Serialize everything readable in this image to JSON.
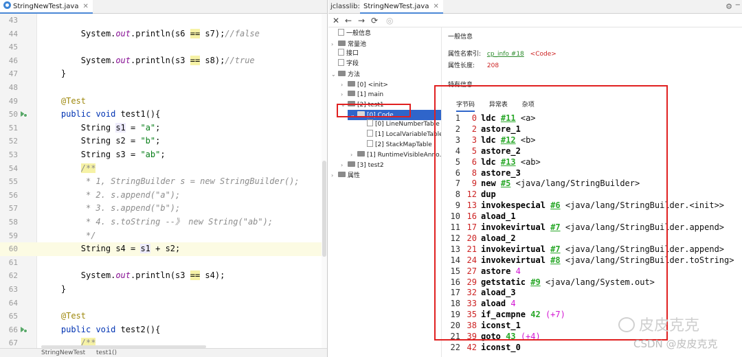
{
  "editor": {
    "tab_label": "StringNewTest.java",
    "lines": [
      {
        "num": "43",
        "code": []
      },
      {
        "num": "44",
        "code": [
          {
            "t": "System.",
            "c": ""
          },
          {
            "t": "out",
            "c": "fld"
          },
          {
            "t": ".println(s6 ",
            "c": ""
          },
          {
            "t": "==",
            "c": "op"
          },
          {
            "t": " s7);",
            "c": ""
          },
          {
            "t": "//false",
            "c": "cmt"
          }
        ],
        "indent": 8
      },
      {
        "num": "45",
        "code": []
      },
      {
        "num": "46",
        "code": [
          {
            "t": "System.",
            "c": ""
          },
          {
            "t": "out",
            "c": "fld"
          },
          {
            "t": ".println(s3 ",
            "c": ""
          },
          {
            "t": "==",
            "c": "op"
          },
          {
            "t": " s8);",
            "c": ""
          },
          {
            "t": "//true",
            "c": "cmt"
          }
        ],
        "indent": 8
      },
      {
        "num": "47",
        "code": [
          {
            "t": "}",
            "c": ""
          }
        ],
        "indent": 4
      },
      {
        "num": "48",
        "code": []
      },
      {
        "num": "49",
        "code": [
          {
            "t": "@Test",
            "c": "ann"
          }
        ],
        "indent": 4
      },
      {
        "num": "50",
        "code": [
          {
            "t": "public void ",
            "c": "kw"
          },
          {
            "t": "test1(){",
            "c": ""
          }
        ],
        "indent": 4,
        "marker": true
      },
      {
        "num": "51",
        "code": [
          {
            "t": "String ",
            "c": ""
          },
          {
            "t": "s1",
            "c": "hl"
          },
          {
            "t": " = ",
            "c": ""
          },
          {
            "t": "\"a\"",
            "c": "str"
          },
          {
            "t": ";",
            "c": ""
          }
        ],
        "indent": 8
      },
      {
        "num": "52",
        "code": [
          {
            "t": "String s2 = ",
            "c": ""
          },
          {
            "t": "\"b\"",
            "c": "str"
          },
          {
            "t": ";",
            "c": ""
          }
        ],
        "indent": 8
      },
      {
        "num": "53",
        "code": [
          {
            "t": "String s3 = ",
            "c": ""
          },
          {
            "t": "\"ab\"",
            "c": "str"
          },
          {
            "t": ";",
            "c": ""
          }
        ],
        "indent": 8
      },
      {
        "num": "54",
        "code": [
          {
            "t": "/**",
            "c": "cmt op"
          }
        ],
        "indent": 8
      },
      {
        "num": "55",
        "code": [
          {
            "t": " * 1, StringBuilder s = new StringBuilder();",
            "c": "cmt"
          }
        ],
        "indent": 8
      },
      {
        "num": "56",
        "code": [
          {
            "t": " * 2. s.append(\"a\");",
            "c": "cmt"
          }
        ],
        "indent": 8
      },
      {
        "num": "57",
        "code": [
          {
            "t": " * 3. s.append(\"b\");",
            "c": "cmt"
          }
        ],
        "indent": 8
      },
      {
        "num": "58",
        "code": [
          {
            "t": " * 4. s.toString --》 new String(\"ab\");",
            "c": "cmt"
          }
        ],
        "indent": 8
      },
      {
        "num": "59",
        "code": [
          {
            "t": " */",
            "c": "cmt"
          }
        ],
        "indent": 8
      },
      {
        "num": "60",
        "code": [
          {
            "t": "String s4 = ",
            "c": ""
          },
          {
            "t": "s1",
            "c": "hl"
          },
          {
            "t": " + s2;",
            "c": ""
          }
        ],
        "indent": 8,
        "current": true
      },
      {
        "num": "61",
        "code": []
      },
      {
        "num": "62",
        "code": [
          {
            "t": "System.",
            "c": ""
          },
          {
            "t": "out",
            "c": "fld"
          },
          {
            "t": ".println(s3 ",
            "c": ""
          },
          {
            "t": "==",
            "c": "op"
          },
          {
            "t": " s4);",
            "c": ""
          }
        ],
        "indent": 8
      },
      {
        "num": "63",
        "code": [
          {
            "t": "}",
            "c": ""
          }
        ],
        "indent": 4
      },
      {
        "num": "64",
        "code": []
      },
      {
        "num": "65",
        "code": [
          {
            "t": "@Test",
            "c": "ann"
          }
        ],
        "indent": 4
      },
      {
        "num": "66",
        "code": [
          {
            "t": "public void ",
            "c": "kw"
          },
          {
            "t": "test2(){",
            "c": ""
          }
        ],
        "indent": 4,
        "marker": true
      },
      {
        "num": "67",
        "code": [
          {
            "t": "/**",
            "c": "cmt op"
          }
        ],
        "indent": 8
      }
    ],
    "breadcrumb": [
      "StringNewTest",
      "test1()"
    ]
  },
  "jclasslib": {
    "panel_label": "jclasslib:",
    "tab_label": "StringNewTest.java",
    "toolbar": {
      "close": "✕",
      "back": "←",
      "forward": "→",
      "refresh": "⟳",
      "web": "◎"
    },
    "tree": [
      {
        "label": "一般信息",
        "depth": 0,
        "kind": "leaf",
        "arrow": ""
      },
      {
        "label": "常量池",
        "depth": 0,
        "kind": "folder",
        "arrow": "›"
      },
      {
        "label": "接口",
        "depth": 0,
        "kind": "leaf",
        "arrow": ""
      },
      {
        "label": "字段",
        "depth": 0,
        "kind": "leaf",
        "arrow": ""
      },
      {
        "label": "方法",
        "depth": 0,
        "kind": "folder",
        "arrow": "⌄"
      },
      {
        "label": "[0] <init>",
        "depth": 1,
        "kind": "folder",
        "arrow": "›"
      },
      {
        "label": "[1] main",
        "depth": 1,
        "kind": "folder",
        "arrow": "›"
      },
      {
        "label": "[2] test1",
        "depth": 1,
        "kind": "folder",
        "arrow": "⌄"
      },
      {
        "label": "[0] Code",
        "depth": 2,
        "kind": "folder",
        "arrow": "⌄",
        "selected": true
      },
      {
        "label": "[0] LineNumberTable",
        "depth": 3,
        "kind": "leaf",
        "arrow": ""
      },
      {
        "label": "[1] LocalVariableTable",
        "depth": 3,
        "kind": "leaf",
        "arrow": ""
      },
      {
        "label": "[2] StackMapTable",
        "depth": 3,
        "kind": "leaf",
        "arrow": ""
      },
      {
        "label": "[1] RuntimeVisibleAnno...",
        "depth": 2,
        "kind": "folder",
        "arrow": "›"
      },
      {
        "label": "[3] test2",
        "depth": 1,
        "kind": "folder",
        "arrow": "›"
      },
      {
        "label": "属性",
        "depth": 0,
        "kind": "folder",
        "arrow": "›"
      }
    ],
    "general_section": "一般信息",
    "name_index_label": "属性名索引:",
    "name_index_link": "cp_info #18",
    "name_index_value": "<Code>",
    "attr_length_label": "属性长度:",
    "attr_length_value": "208",
    "specific_section": "特有信息",
    "subtabs": [
      "字节码",
      "异常表",
      "杂项"
    ],
    "bytecode": [
      {
        "n": "1",
        "off": "0",
        "op": "ldc",
        "ref": "#11",
        "arg": "<a>"
      },
      {
        "n": "2",
        "off": "2",
        "op": "astore_1"
      },
      {
        "n": "3",
        "off": "3",
        "op": "ldc",
        "ref": "#12",
        "arg": "<b>"
      },
      {
        "n": "4",
        "off": "5",
        "op": "astore_2"
      },
      {
        "n": "5",
        "off": "6",
        "op": "ldc",
        "ref": "#13",
        "arg": "<ab>"
      },
      {
        "n": "6",
        "off": "8",
        "op": "astore_3"
      },
      {
        "n": "7",
        "off": "9",
        "op": "new",
        "ref": "#5",
        "arg": "<java/lang/StringBuilder>"
      },
      {
        "n": "8",
        "off": "12",
        "op": "dup"
      },
      {
        "n": "9",
        "off": "13",
        "op": "invokespecial",
        "ref": "#6",
        "arg": "<java/lang/StringBuilder.<init>>"
      },
      {
        "n": "10",
        "off": "16",
        "op": "aload_1"
      },
      {
        "n": "11",
        "off": "17",
        "op": "invokevirtual",
        "ref": "#7",
        "arg": "<java/lang/StringBuilder.append>"
      },
      {
        "n": "12",
        "off": "20",
        "op": "aload_2"
      },
      {
        "n": "13",
        "off": "21",
        "op": "invokevirtual",
        "ref": "#7",
        "arg": "<java/lang/StringBuilder.append>"
      },
      {
        "n": "14",
        "off": "24",
        "op": "invokevirtual",
        "ref": "#8",
        "arg": "<java/lang/StringBuilder.toString>"
      },
      {
        "n": "15",
        "off": "27",
        "op": "astore",
        "num": "4"
      },
      {
        "n": "16",
        "off": "29",
        "op": "getstatic",
        "ref": "#9",
        "arg": "<java/lang/System.out>"
      },
      {
        "n": "17",
        "off": "32",
        "op": "aload_3"
      },
      {
        "n": "18",
        "off": "33",
        "op": "aload",
        "num": "4"
      },
      {
        "n": "19",
        "off": "35",
        "op": "if_acmpne",
        "jmp": "42",
        "rel": "(+7)"
      },
      {
        "n": "20",
        "off": "38",
        "op": "iconst_1"
      },
      {
        "n": "21",
        "off": "39",
        "op": "goto",
        "jmp": "43",
        "rel": "(+4)"
      },
      {
        "n": "22",
        "off": "42",
        "op": "iconst_0"
      }
    ]
  },
  "watermark": {
    "text": "皮皮克克",
    "csdn": "CSDN @皮皮克克"
  },
  "colors": {
    "accent": "#2f65ca",
    "annotation_red": "#e02020"
  }
}
